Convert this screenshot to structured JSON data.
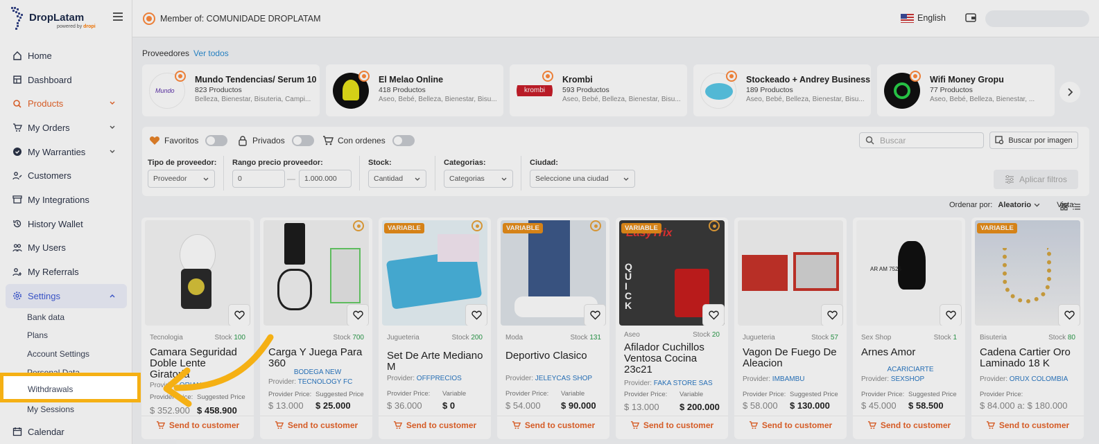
{
  "brand": {
    "name": "DropLatam",
    "by_label": "powered by",
    "by_brand": "dropi"
  },
  "sidebar": {
    "items": [
      {
        "label": "Home",
        "icon": "home-icon"
      },
      {
        "label": "Dashboard",
        "icon": "dashboard-icon"
      },
      {
        "label": "Products",
        "icon": "search-icon",
        "expandable": true
      },
      {
        "label": "My Orders",
        "icon": "cart-icon",
        "expandable": true
      },
      {
        "label": "My Warranties",
        "icon": "shield-check-icon",
        "expandable": true
      },
      {
        "label": "Customers",
        "icon": "customers-icon"
      },
      {
        "label": "My Integrations",
        "icon": "store-icon"
      },
      {
        "label": "History Wallet",
        "icon": "history-icon"
      },
      {
        "label": "My Users",
        "icon": "users-icon"
      },
      {
        "label": "My Referrals",
        "icon": "referrals-icon"
      },
      {
        "label": "Settings",
        "icon": "gear-icon",
        "expanded": true
      }
    ],
    "sub_items": [
      "Bank data",
      "Plans",
      "Account Settings",
      "Personal Data",
      "Withdrawals",
      "My Sessions"
    ],
    "highlighted": "Withdrawals",
    "after": {
      "label": "Calendar",
      "icon": "calendar-icon"
    }
  },
  "topbar": {
    "member": "Member of: COMUNIDADE DROPLATAM",
    "language": "English"
  },
  "providers": {
    "heading": "Proveedores",
    "see_all": "Ver todos",
    "cards": [
      {
        "name": "Mundo Tendencias/ Serum 10",
        "count": "823 Productos",
        "cats": "Belleza, Bienestar, Bisuteria, Campi..."
      },
      {
        "name": "El Melao Online",
        "count": "418 Productos",
        "cats": "Aseo, Bebé, Belleza, Bienestar, Bisu..."
      },
      {
        "name": "Krombi",
        "count": "593 Productos",
        "cats": "Aseo, Bebé, Belleza, Bienestar, Bisu..."
      },
      {
        "name": "Stockeado + Andrey Business",
        "count": "189 Productos",
        "cats": "Aseo, Bebé, Belleza, Bienestar, Bisu..."
      },
      {
        "name": "Wifi Money Gropu",
        "count": "77 Productos",
        "cats": "Aseo, Bebé, Belleza, Bienestar, ..."
      }
    ]
  },
  "filters": {
    "favoritos": "Favoritos",
    "privados": "Privados",
    "con_ordenes": "Con ordenes",
    "search_placeholder": "Buscar",
    "image_search": "Buscar por imagen",
    "tipo_label": "Tipo de proveedor:",
    "tipo_value": "Proveedor",
    "rango_label": "Rango precio proveedor:",
    "rango_min": "0",
    "rango_max": "1.000.000",
    "stock_label": "Stock:",
    "stock_value": "Cantidad",
    "cat_label": "Categorias:",
    "cat_value": "Categorias",
    "ciudad_label": "Ciudad:",
    "ciudad_value": "Seleccione una ciudad",
    "apply": "Aplicar filtros",
    "sort_label": "Ordenar por:",
    "sort_value": "Aleatorio",
    "view_label": "Vista:"
  },
  "products": [
    {
      "category": "Tecnologia",
      "stock_label": "Stock",
      "stock": "100",
      "title": "Camara Seguridad Doble Lente Giratoria",
      "provider_label": "Provider:",
      "provider": "ORIANA",
      "pp_label": "Provider Price:",
      "pp": "$ 352.900",
      "sp_label": "Suggested Price",
      "sp": "$ 458.900",
      "variable": false,
      "verified": false
    },
    {
      "category": "",
      "stock_label": "Stock",
      "stock": "700",
      "title": "Carga Y Juega Para 360",
      "bodega": "BODEGA NEW",
      "provider_label": "Provider:",
      "provider": "TECNOLOGY FC",
      "pp_label": "Provider Price:",
      "pp": "$ 13.000",
      "sp_label": "Suggested Price",
      "sp": "$ 25.000",
      "variable": false,
      "verified": true
    },
    {
      "category": "Jugueteria",
      "stock_label": "Stock",
      "stock": "200",
      "title": "Set De Arte Mediano M",
      "provider_label": "Provider:",
      "provider": "OFFPRECIOS",
      "pp_label": "Provider Price:",
      "pp": "$ 36.000",
      "sp_label": "Variable",
      "sp": "$ 0",
      "variable": true,
      "verified": true
    },
    {
      "category": "Moda",
      "stock_label": "Stock",
      "stock": "131",
      "title": "Deportivo Clasico",
      "provider_label": "Provider:",
      "provider": "JELEYCAS SHOP",
      "pp_label": "Provider Price:",
      "pp": "$ 54.000",
      "sp_label": "Variable",
      "sp": "$ 90.000",
      "variable": true,
      "verified": true
    },
    {
      "category": "Aseo",
      "stock_label": "Stock",
      "stock": "20",
      "title": "Afilador Cuchillos Ventosa Cocina 23c21",
      "provider_label": "Provider:",
      "provider": "FAKA STORE SAS",
      "pp_label": "Provider Price:",
      "pp": "$ 13.000",
      "sp_label": "Variable",
      "sp": "$ 200.000",
      "variable": true,
      "verified": true
    },
    {
      "category": "Jugueteria",
      "stock_label": "Stock",
      "stock": "57",
      "title": "Vagon De Fuego De Aleacion",
      "provider_label": "Provider:",
      "provider": "IMBAMBU",
      "pp_label": "Provider Price:",
      "pp": "$ 58.000",
      "sp_label": "Suggested Price",
      "sp": "$ 130.000",
      "variable": false,
      "verified": false
    },
    {
      "category": "Sex Shop",
      "stock_label": "Stock",
      "stock": "1",
      "title": "Arnes Amor",
      "bodega": "ACARICIARTE",
      "provider_label": "Provider:",
      "provider": "SEXSHOP",
      "pp_label": "Provider Price:",
      "pp": "$ 45.000",
      "sp_label": "Suggested Price",
      "sp": "$ 58.500",
      "variable": false,
      "verified": false
    },
    {
      "category": "Bisuteria",
      "stock_label": "Stock",
      "stock": "80",
      "title": "Cadena Cartier Oro Laminado 18 K",
      "provider_label": "Provider:",
      "provider": "ORUX COLOMBIA",
      "pp_label": "Provider Price:",
      "pp": "$ 84.000 a: $ 180.000",
      "sp_label": "",
      "sp": "",
      "variable": true,
      "verified": false
    }
  ],
  "product_labels": {
    "variable_badge": "VARIABLE",
    "send": "Send to customer"
  },
  "colors": {
    "accent": "#e8642a",
    "highlight": "#f5b014",
    "link": "#2a8bd1",
    "settings": "#3f5bd6"
  }
}
